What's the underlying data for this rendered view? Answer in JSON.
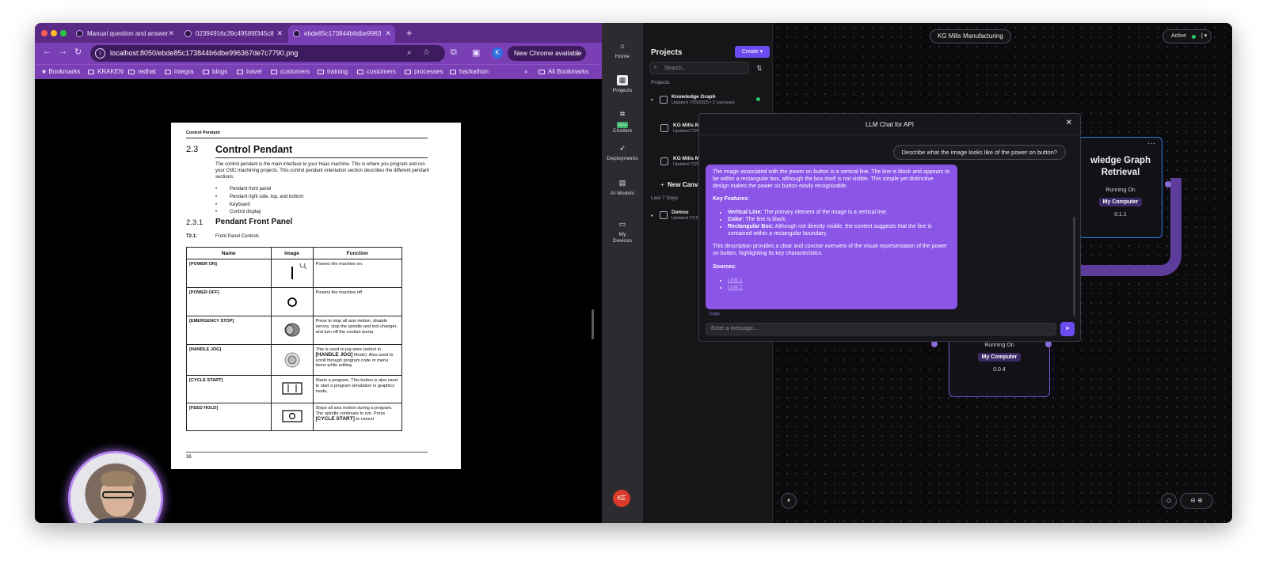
{
  "browser": {
    "tabs": [
      {
        "title": "Manual question and answer"
      },
      {
        "title": "02394916c39c49589f345c8"
      },
      {
        "title": "ebde85c173844b6dbe9963"
      }
    ],
    "url": "localhost:8050/ebde85c173844b6dbe996367de7c7790.png",
    "profile_initial": "K",
    "update_button": "New Chrome available",
    "bookmarks": [
      "Bookmarks",
      "KRAKEN",
      "redhat",
      "integra",
      "blogs",
      "travel",
      "customers",
      "training",
      "customers",
      "processes",
      "hackathon"
    ],
    "all_bookmarks": "All Bookmarks",
    "overflow": "»"
  },
  "pdf": {
    "running_head": "Control Pendant",
    "section_num": "2.3",
    "section_title": "Control Pendant",
    "intro": "The control pendant is the main interface to your Haas machine. This is where you program and run your CNC machining projects. This control pendant orientation section describes the different pendant sections:",
    "bullets": [
      "Pendant front panel",
      "Pendant right side, top, and bottom",
      "Keyboard",
      "Control display"
    ],
    "subsection_num": "2.3.1",
    "subsection_title": "Pendant Front Panel",
    "table_num": "T2.1:",
    "table_title": "Front Panel Controls",
    "table_headers": [
      "Name",
      "Image",
      "Function"
    ],
    "rows": [
      {
        "name": "[POWER ON]",
        "function": "Powers the machine on."
      },
      {
        "name": "[POWER OFF]",
        "function": "Powers the machine off."
      },
      {
        "name": "[EMERGENCY STOP]",
        "function": "Press to stop all axis motion, disable servos, stop the spindle and tool changer, and turn off the coolant pump."
      },
      {
        "name": "[HANDLE JOG]",
        "function_pre": "This is used to jog axes (select in",
        "function_bold": "[HANDLE JOG]",
        "function_post": "Mode). Also used to scroll through program code or menu items while editing."
      },
      {
        "name": "[CYCLE START]",
        "function": "Starts a program. This button is also used to start a program simulation in graphics mode."
      },
      {
        "name": "[FEED HOLD]",
        "function_pre": "Stops all axis motion during a program. The spindle continues to run. Press",
        "function_bold": "[CYCLE START]",
        "function_post": "to cancel."
      }
    ],
    "page_number": "36"
  },
  "rail": {
    "items": [
      {
        "label": "Home",
        "icon": "home-icon",
        "glyph": "⌂"
      },
      {
        "label": "Projects",
        "icon": "projects-icon",
        "glyph": "▦"
      },
      {
        "label": "Clusters",
        "icon": "clusters-icon",
        "glyph": "✲",
        "badge": "BETA"
      },
      {
        "label": "Deployments",
        "icon": "rocket-icon",
        "glyph": "➶"
      },
      {
        "label": "AI Models",
        "icon": "ai-models-icon",
        "glyph": "▤"
      },
      {
        "label": "My Devices",
        "icon": "devices-icon",
        "glyph": "▭"
      }
    ],
    "avatar": "KE"
  },
  "projects_panel": {
    "title": "Projects",
    "create": "Create",
    "search_placeholder": "Search...",
    "section_projects": "Projects",
    "items": [
      {
        "name": "Knowledge Graph",
        "meta": "Updated 7/25/2025 • 2 canvases"
      },
      {
        "name": "KG Mills Man",
        "meta": "Updated 7/25/2"
      },
      {
        "name": "KG Mills Man",
        "meta": "Updated 7/25/2"
      }
    ],
    "new_canvas": "New Canvas",
    "section_recent": "Last 7 Days",
    "demos": {
      "name": "Demos",
      "meta": "Updated 7/17/2"
    }
  },
  "canvas": {
    "title": "KG Mills Manufacturing",
    "status": "Active",
    "node_top": {
      "title_line1": "wledge Graph",
      "title_line2": "Retrieval",
      "running": "Running On",
      "computer": "My Computer",
      "version": "0.1.1"
    },
    "node_bottom": {
      "running": "Running On",
      "computer": "My Computer",
      "version": "0.0.4"
    }
  },
  "chat": {
    "title": "LLM Chat for API",
    "user_message": "Describe what the image looks like of the power on button?",
    "response_intro": "The image associated with the power on button is a vertical line. The line is black and appears to be within a rectangular box, although the box itself is not visible. This simple yet distinctive design makes the power on button easily recognizable.",
    "key_features_label": "Key Features:",
    "features": [
      {
        "label": "Vertical Line:",
        "text": "The primary element of the image is a vertical line."
      },
      {
        "label": "Color:",
        "text": "The line is black."
      },
      {
        "label": "Rectangular Box:",
        "text": "Although not directly visible, the context suggests that the line is contained within a rectangular boundary."
      }
    ],
    "summary": "This description provides a clear and concise overview of the visual representation of the power on button, highlighting its key characteristics.",
    "sources_label": "Sources:",
    "sources": [
      "Link 1",
      "Link 2"
    ],
    "copy": "Copy",
    "input_placeholder": "Enter a message..."
  }
}
